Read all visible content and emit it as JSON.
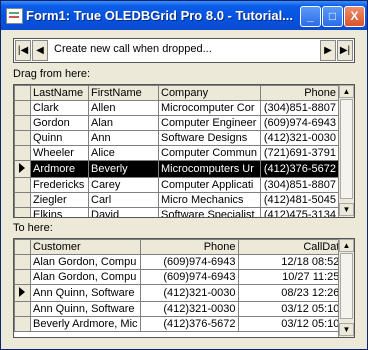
{
  "window": {
    "title": "Form1:  True OLEDBGrid Pro 8.0 - Tutorial...",
    "controls": [
      "_",
      "□",
      "X"
    ]
  },
  "navigator": {
    "first": "|◀",
    "prev": "◀",
    "caption": "Create new call when dropped...",
    "next": "▶",
    "last": "▶|"
  },
  "drag_label": "Drag from here:",
  "to_label": "To here:",
  "top_grid": {
    "columns": [
      "LastName",
      "FirstName",
      "Company",
      "Phone"
    ],
    "rows": [
      [
        "Clark",
        "Allen",
        "Microcomputer Cor",
        "(304)851-8807"
      ],
      [
        "Gordon",
        "Alan",
        "Computer Engineer",
        "(609)974-6943"
      ],
      [
        "Quinn",
        "Ann",
        "Software Designs",
        "(412)321-0030"
      ],
      [
        "Wheeler",
        "Alice",
        "Computer Commun",
        "(721)691-3791"
      ],
      [
        "Ardmore",
        "Beverly",
        "Microcomputers Ur",
        "(412)376-5672"
      ],
      [
        "Fredericks",
        "Carey",
        "Computer Applicati",
        "(304)851-8807"
      ],
      [
        "Ziegler",
        "Carl",
        "Micro Mechanics",
        "(412)481-5045"
      ],
      [
        "Elkins",
        "David",
        "Software Specialist",
        "(412)475-3134"
      ]
    ],
    "selected_row": 4
  },
  "bottom_grid": {
    "columns": [
      "Customer",
      "Phone",
      "CallDate"
    ],
    "rows": [
      [
        "Alan Gordon, Compu",
        "(609)974-6943",
        "12/18 08:52p"
      ],
      [
        "Alan Gordon, Compu",
        "(609)974-6943",
        "10/27 11:25a"
      ],
      [
        "Ann Quinn, Software",
        "(412)321-0030",
        "08/23 12:26p"
      ],
      [
        "Ann Quinn, Software",
        "(412)321-0030",
        "03/12 05:10p"
      ],
      [
        "Beverly Ardmore, Mic",
        "(412)376-5672",
        "03/12 05:10p"
      ]
    ],
    "current_row": 2
  }
}
